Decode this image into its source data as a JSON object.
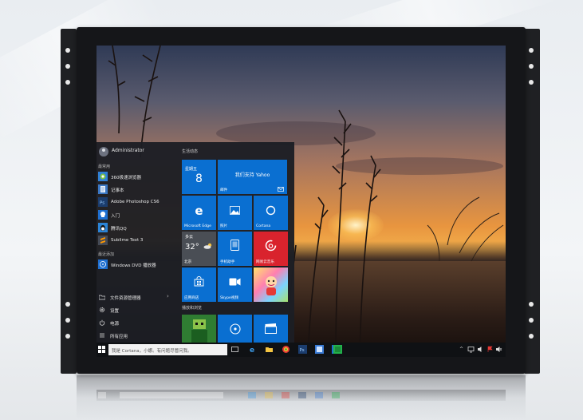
{
  "start_menu": {
    "user": "Administrator",
    "section_most_used": "最常用",
    "apps": [
      {
        "label": "360极速浏览器",
        "icon": "browser-360-icon",
        "color": "#2f7fd4"
      },
      {
        "label": "记事本",
        "icon": "notepad-icon",
        "color": "#3b78c4"
      },
      {
        "label": "Adobe Photoshop CS6",
        "icon": "photoshop-icon",
        "color": "#1b3d6e"
      },
      {
        "label": "入门",
        "icon": "tips-icon",
        "color": "#1e6fd0"
      },
      {
        "label": "腾讯QQ",
        "icon": "qq-icon",
        "color": "#2b84d6"
      },
      {
        "label": "Sublime Text 3",
        "icon": "sublime-icon",
        "color": "#444a55"
      }
    ],
    "section_recent": "最近添加",
    "recent_apps": [
      {
        "label": "Windows DVD 播放器",
        "icon": "dvd-player-icon",
        "color": "#1e6fd0"
      }
    ],
    "system": [
      {
        "label": "文件资源管理器",
        "icon": "folder-icon"
      },
      {
        "label": "设置",
        "icon": "gear-icon"
      },
      {
        "label": "电源",
        "icon": "power-icon"
      },
      {
        "label": "所有应用",
        "icon": "list-icon"
      }
    ],
    "group_life": "生活动态",
    "group_play": "播放和浏览",
    "tiles": {
      "calendar": {
        "day": "星期五",
        "date": "8"
      },
      "mail": {
        "title": "我们支持 Yahoo",
        "label": "邮件"
      },
      "edge": {
        "label": "Microsoft Edge"
      },
      "photos": {
        "label": "照片"
      },
      "cortana": {
        "label": "Cortana"
      },
      "weather": {
        "condition": "多云",
        "temp": "32°",
        "range": "32°\n27°",
        "city": "北京"
      },
      "phone": {
        "label": "手机助手"
      },
      "music": {
        "label": "网易云音乐"
      },
      "store": {
        "label": "应用商店"
      },
      "skype": {
        "label": "Skype视频"
      }
    }
  },
  "taskbar": {
    "search_placeholder": "我是 Cortana，小娜。有问题尽管问我。"
  },
  "colors": {
    "tile_blue": "#0a6fd1",
    "tile_red": "#d9232d",
    "tile_green": "#2f7d32",
    "bezel": "#151619"
  }
}
